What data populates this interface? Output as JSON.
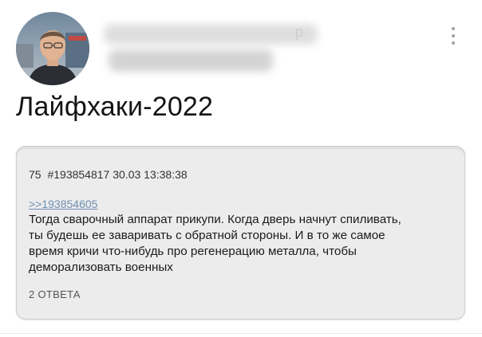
{
  "header": {
    "avatar_icon": "user-avatar-photo",
    "author_name_blurred_glyph": "p",
    "menu_icon": "more-vertical-icon"
  },
  "post": {
    "title": "Лайфхаки-2022"
  },
  "card": {
    "post_number": "75",
    "post_id": "#193854817",
    "date": "30.03",
    "time": "13:38:38",
    "reply_link": ">>193854605",
    "body_lines": [
      "Тогда сварочный аппарат прикупи. Когда дверь начнут спиливать,",
      "ты будешь ее заваривать с обратной стороны. И в то же самое",
      "время кричи что-нибудь про регенерацию металла, чтобы",
      "деморализовать военных"
    ],
    "answers_label": "2 ОТВЕТА"
  },
  "colors": {
    "link": "#6e8fb3",
    "card_background": "#ececec",
    "card_border": "#cfcfcf",
    "text": "#1b1b1b"
  }
}
